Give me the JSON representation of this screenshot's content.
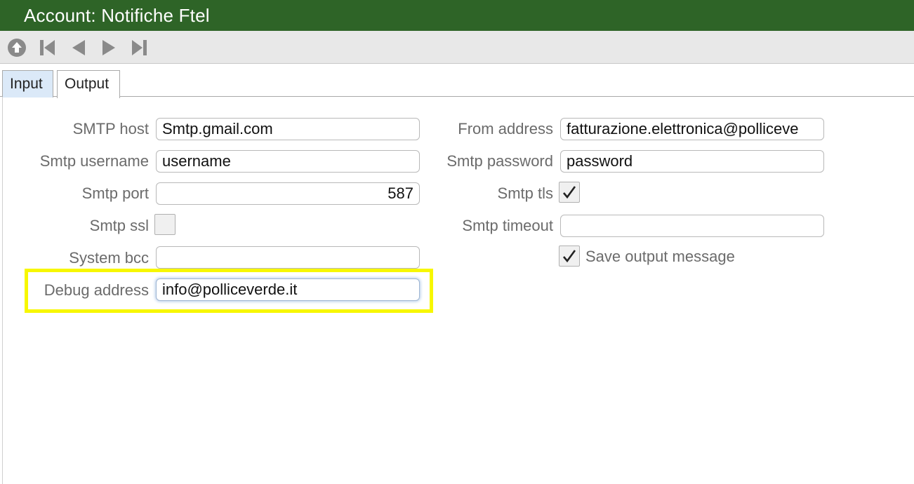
{
  "window": {
    "title": "Account: Notifiche Ftel"
  },
  "toolbar": {
    "buttons": [
      {
        "icon": "up-circle-icon"
      },
      {
        "icon": "first-record-icon"
      },
      {
        "icon": "previous-record-icon"
      },
      {
        "icon": "next-record-icon"
      },
      {
        "icon": "last-record-icon"
      }
    ]
  },
  "tabs": [
    {
      "label": "Input",
      "active": false
    },
    {
      "label": "Output",
      "active": true
    }
  ],
  "form": {
    "smtp_host": {
      "label": "SMTP host",
      "value": "Smtp.gmail.com"
    },
    "from_address": {
      "label": "From address",
      "value": "fatturazione.elettronica@polliceve"
    },
    "smtp_username": {
      "label": "Smtp username",
      "value": "username"
    },
    "smtp_password": {
      "label": "Smtp password",
      "value": "password"
    },
    "smtp_port": {
      "label": "Smtp port",
      "value": "587"
    },
    "smtp_tls": {
      "label": "Smtp tls",
      "checked": true
    },
    "smtp_ssl": {
      "label": "Smtp ssl",
      "checked": false
    },
    "smtp_timeout": {
      "label": "Smtp timeout",
      "value": ""
    },
    "system_bcc": {
      "label": "System bcc",
      "value": ""
    },
    "save_output_message": {
      "label": "Save output message",
      "checked": true
    },
    "debug_address": {
      "label": "Debug address",
      "value": "info@polliceverde.it"
    }
  },
  "colors": {
    "titlebar": "#2e6427",
    "highlight": "#f7f700",
    "active_tab": "#dbe9f8"
  }
}
